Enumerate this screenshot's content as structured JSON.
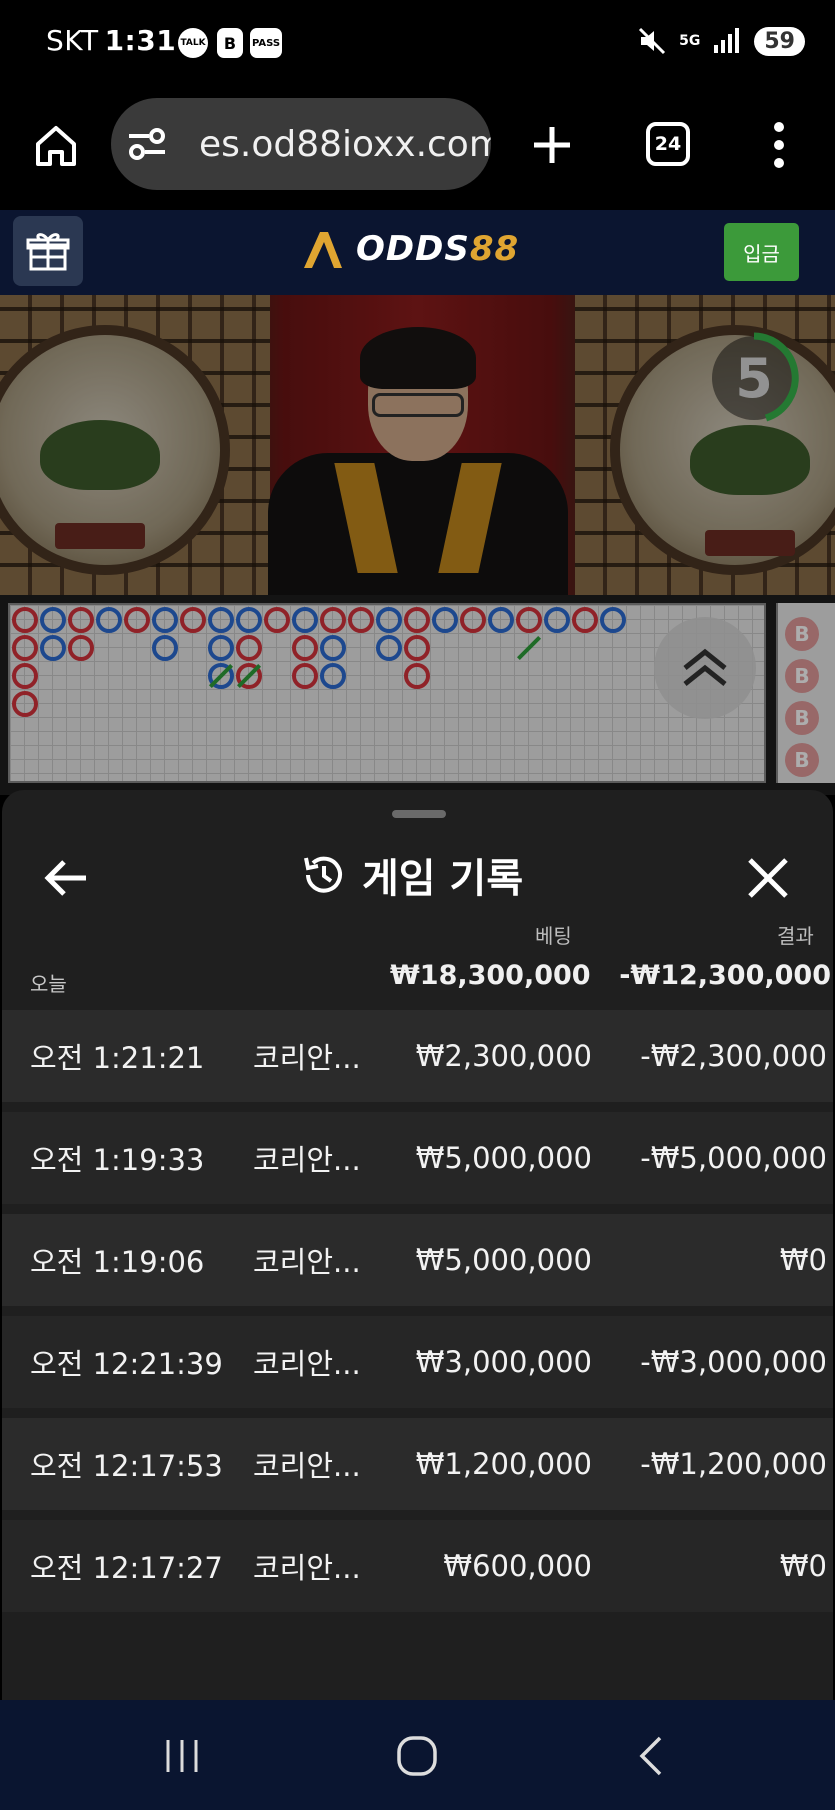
{
  "status_bar": {
    "carrier": "SKT",
    "time": "1:31",
    "notification_icons": [
      "talk-icon",
      "b-icon",
      "pass-icon"
    ],
    "talk_label": "TALK",
    "b_label": "B",
    "pass_label": "PASS",
    "network_label": "5G",
    "battery": "59"
  },
  "browser": {
    "url": "es.od88ioxx.com",
    "tab_count": "24"
  },
  "site": {
    "logo_prefix": "ODDS",
    "logo_suffix": "88",
    "deposit_label": "입금",
    "accent_color": "#3c9a3a",
    "brand_gold": "#e0a531"
  },
  "video": {
    "countdown": "5"
  },
  "roadmap": {
    "side_label": "B"
  },
  "history": {
    "title": "게임 기록",
    "col_bet": "베팅",
    "col_result": "결과",
    "today_label": "오늘",
    "today_bet_total": "₩18,300,000",
    "today_result_total": "-₩12,300,000",
    "rows": [
      {
        "time": "오전 1:21:21",
        "game": "코리안...",
        "bet": "₩2,300,000",
        "result": "-₩2,300,000"
      },
      {
        "time": "오전 1:19:33",
        "game": "코리안...",
        "bet": "₩5,000,000",
        "result": "-₩5,000,000"
      },
      {
        "time": "오전 1:19:06",
        "game": "코리안...",
        "bet": "₩5,000,000",
        "result": "₩0"
      },
      {
        "time": "오전 12:21:39",
        "game": "코리안...",
        "bet": "₩3,000,000",
        "result": "-₩3,000,000"
      },
      {
        "time": "오전 12:17:53",
        "game": "코리안...",
        "bet": "₩1,200,000",
        "result": "-₩1,200,000"
      },
      {
        "time": "오전 12:17:27",
        "game": "코리안...",
        "bet": "₩600,000",
        "result": "₩0"
      }
    ]
  }
}
